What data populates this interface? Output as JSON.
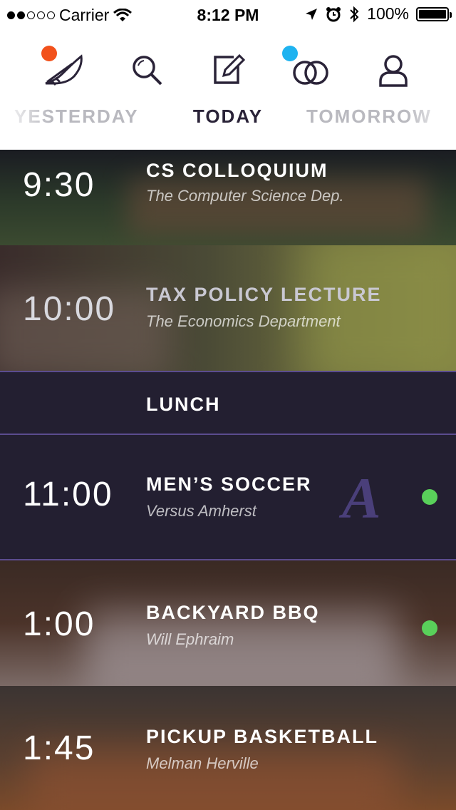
{
  "status_bar": {
    "carrier": "Carrier",
    "time": "8:12 PM",
    "battery": "100%"
  },
  "nav": {
    "icons": [
      "feather-icon",
      "search-icon",
      "compose-icon",
      "rings-icon",
      "profile-icon"
    ],
    "badge_colors": {
      "feather": "#f2511b",
      "rings": "#1fb3f0"
    },
    "day_tabs": {
      "yesterday": "YESTERDAY",
      "today": "TODAY",
      "tomorrow": "TOMORROW"
    }
  },
  "events": [
    {
      "time": "9:30",
      "title": "CS COLLOQUIUM",
      "subtitle": "The Computer Science Dep."
    },
    {
      "time": "10:00",
      "title": "TAX POLICY LECTURE",
      "subtitle": "The Economics Department"
    },
    {
      "time": "",
      "title": "LUNCH",
      "subtitle": ""
    },
    {
      "time": "11:00",
      "title": "MEN’S SOCCER",
      "subtitle": "Versus Amherst",
      "logo": "A",
      "live": true
    },
    {
      "time": "1:00",
      "title": "BACKYARD BBQ",
      "subtitle": "Will Ephraim",
      "live": true
    },
    {
      "time": "1:45",
      "title": "PICKUP BASKETBALL",
      "subtitle": "Melman Herville"
    }
  ],
  "colors": {
    "accent": "#5b4c8f",
    "live_dot": "#59d05a",
    "dark_row": "#231f31"
  }
}
